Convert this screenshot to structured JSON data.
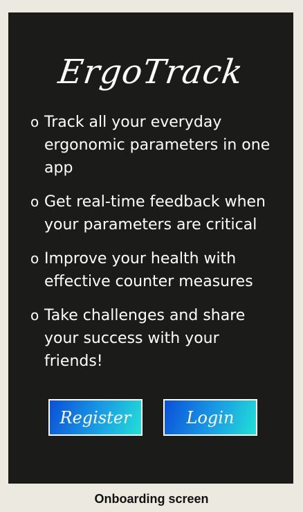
{
  "app": {
    "name": "ErgoTrack"
  },
  "features": [
    {
      "bullet": "o",
      "text": "Track all your everyday ergonomic parameters in one app"
    },
    {
      "bullet": "o",
      "text": "Get real-time feedback when your parameters are critical"
    },
    {
      "bullet": "o",
      "text": "Improve your health with effective counter measures"
    },
    {
      "bullet": "o",
      "text": "Take challenges and share your success with your friends!"
    }
  ],
  "actions": {
    "register_label": "Register",
    "login_label": "Login"
  },
  "caption": "Onboarding screen",
  "colors": {
    "background": "#eceae0",
    "screen": "#1b1b19",
    "button_gradient_start": "#0b50d8",
    "button_gradient_end": "#22e0d6"
  }
}
